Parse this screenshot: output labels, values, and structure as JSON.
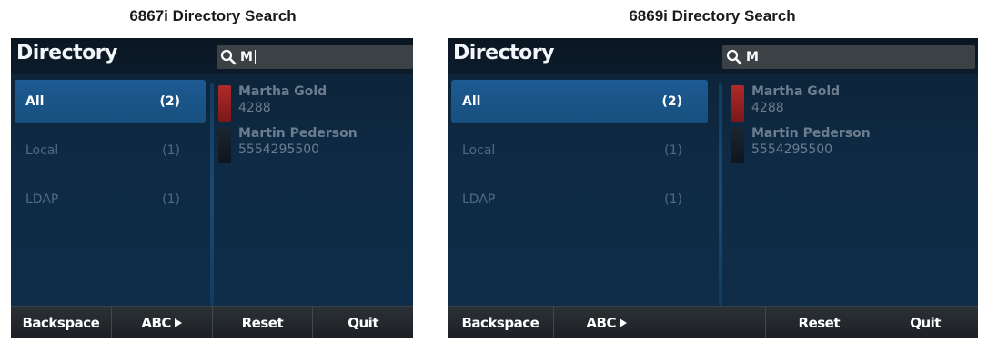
{
  "captions": {
    "left": "6867i Directory Search",
    "right": "6869i Directory Search"
  },
  "phones": [
    {
      "title": "Directory",
      "search": {
        "icon": "search-icon",
        "value": "M"
      },
      "categories": [
        {
          "label": "All",
          "count": "(2)"
        },
        {
          "label": "Local",
          "count": "(1)"
        },
        {
          "label": "LDAP",
          "count": "(1)"
        }
      ],
      "contacts": [
        {
          "name": "Martha Gold",
          "number": "4288",
          "status_color": "#b02a2a"
        },
        {
          "name": "Martin Pederson",
          "number": "5554295500",
          "status_color": "#1b2630"
        }
      ],
      "softkeys": [
        "Backspace",
        "ABC",
        "Reset",
        "Quit"
      ]
    },
    {
      "title": "Directory",
      "search": {
        "icon": "search-icon",
        "value": "M"
      },
      "categories": [
        {
          "label": "All",
          "count": "(2)"
        },
        {
          "label": "Local",
          "count": "(1)"
        },
        {
          "label": "LDAP",
          "count": "(1)"
        }
      ],
      "contacts": [
        {
          "name": "Martha Gold",
          "number": "4288",
          "status_color": "#b02a2a"
        },
        {
          "name": "Martin Pederson",
          "number": "5554295500",
          "status_color": "#1b2630"
        }
      ],
      "softkeys": [
        "Backspace",
        "ABC",
        "",
        "Reset",
        "Quit"
      ]
    }
  ],
  "colors": {
    "selected_row": "#1d5a92",
    "screen_bg": "#0f2d49",
    "softkey_bg": "#2c3136"
  }
}
